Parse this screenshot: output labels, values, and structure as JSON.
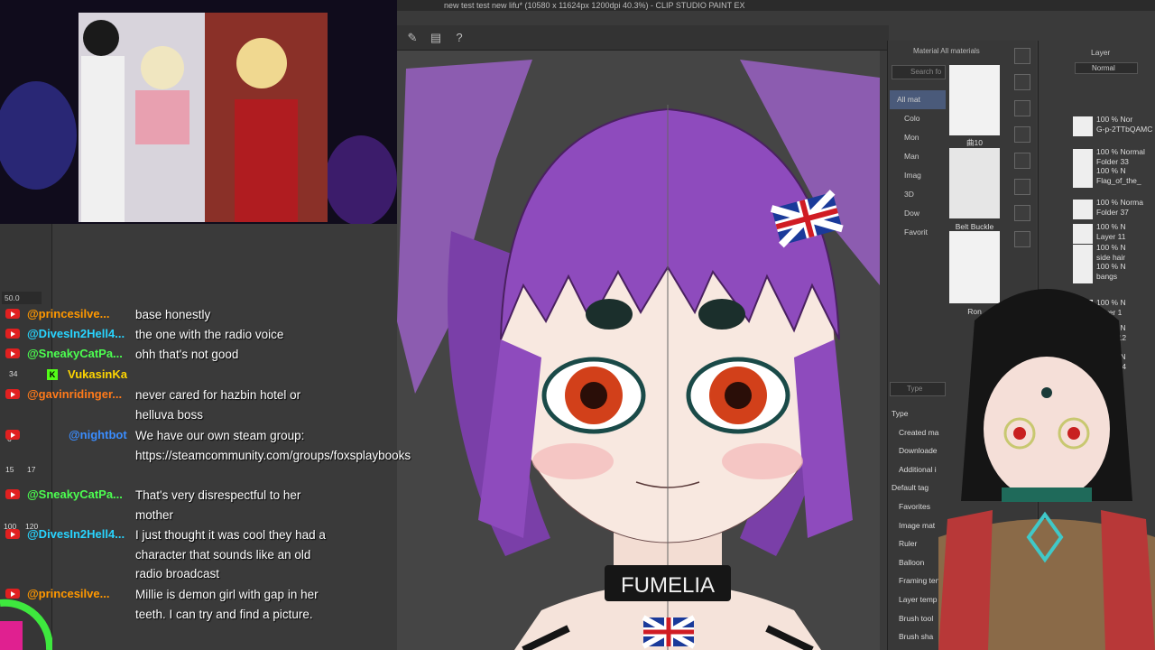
{
  "app": {
    "title": "new test test new lifu* (10580 x 11624px 1200dpi 40.3%) - CLIP STUDIO PAINT EX"
  },
  "canvas": {
    "zoom": "50.0",
    "collar_text": "FUMELIA"
  },
  "material_panel": {
    "header": "Material All materials",
    "search_placeholder": "Search fo",
    "tree": [
      "All mat",
      "Colo",
      "Mon",
      "Man",
      "Imag",
      "3D",
      "Dow",
      "Favorit"
    ],
    "thumb_labels": [
      "曲10",
      "Belt Buckle",
      "Ron"
    ],
    "type_search": "Type",
    "type_list": [
      "Type",
      "Created ma",
      "Downloade",
      "Additional i",
      "Default tag",
      "Favorites",
      "Image mat",
      "Ruler",
      "Balloon",
      "Framing ten",
      "Layer temp",
      "Brush tool",
      "Brush sha"
    ]
  },
  "layer_panel": {
    "header": "Layer",
    "blend_mode": "Normal",
    "layers": [
      {
        "top": "100 % Nor",
        "bottom": "G-p-2TTbQAMC"
      },
      {
        "top": "100 % Normal",
        "bottom": "Folder 33"
      },
      {
        "top": "100 % N",
        "bottom": "Flag_of_the_"
      },
      {
        "top": "100 % Norma",
        "bottom": "Folder 37"
      },
      {
        "top": "100 % N",
        "bottom": "Layer 11"
      },
      {
        "top": "100 % N",
        "bottom": "side hair"
      },
      {
        "top": "100 % N",
        "bottom": "bangs"
      },
      {
        "top": "100 % N",
        "bottom": "Layer 1"
      },
      {
        "top": "100 % N",
        "bottom": "Layer 12"
      },
      {
        "top": "100 % N",
        "bottom": "Layer 14"
      }
    ]
  },
  "toolstrip": {
    "numbers": [
      "34",
      "6",
      "15",
      "17",
      "100",
      "120"
    ]
  },
  "chat": [
    {
      "name": "@princesilve...",
      "text": "base honestly",
      "color": "#ff9800",
      "icon": "youtube"
    },
    {
      "name": "@DivesIn2Hell4...",
      "text": "the one with the radio voice",
      "color": "#28d4ff",
      "icon": "youtube"
    },
    {
      "name": "@SneakyCatPa...",
      "text": "ohh that's not good",
      "color": "#4cff50",
      "icon": "youtube"
    },
    {
      "name": "VukasinKa",
      "text": "",
      "color": "#ffd600",
      "icon": "kick"
    },
    {
      "name": "@gavinridinger...",
      "text": "never cared for hazbin hotel or helluva boss",
      "color": "#ff7a1a",
      "icon": "youtube"
    },
    {
      "name": "@nightbot",
      "text": "We have our own steam group: https://steamcommunity.com/groups/foxsplaybooks",
      "color": "#3a8dff",
      "icon": "bot"
    },
    {
      "name": "@SneakyCatPa...",
      "text": "That's very disrespectful to her mother",
      "color": "#4cff50",
      "icon": "youtube"
    },
    {
      "name": "@DivesIn2Hell4...",
      "text": "I just thought it was cool they had a character that sounds like an old radio broadcast",
      "color": "#28d4ff",
      "icon": "youtube"
    },
    {
      "name": "@princesilve...",
      "text": "Millie is demon girl with gap in her teeth. I can try and find a picture.",
      "color": "#ff9800",
      "icon": "youtube"
    }
  ]
}
